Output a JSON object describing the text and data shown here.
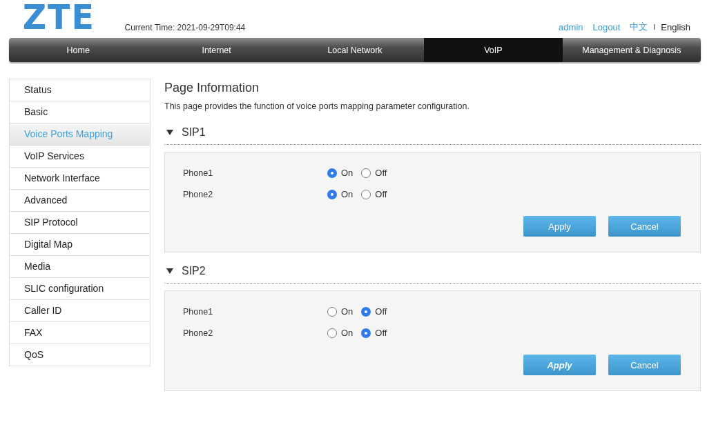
{
  "header": {
    "logo": "ZTE",
    "current_time": "Current Time: 2021-09-29T09:44",
    "user": "admin",
    "logout": "Logout",
    "languages": [
      {
        "label": "中文",
        "selected": false
      },
      {
        "label": "English",
        "selected": true
      }
    ],
    "language_separator": "I"
  },
  "nav": [
    {
      "label": "Home",
      "selected": false
    },
    {
      "label": "Internet",
      "selected": false
    },
    {
      "label": "Local Network",
      "selected": false
    },
    {
      "label": "VoIP",
      "selected": true
    },
    {
      "label": "Management & Diagnosis",
      "selected": false
    }
  ],
  "sidebar": {
    "items": [
      {
        "label": "Status",
        "selected": false
      },
      {
        "label": "Basic",
        "selected": false
      },
      {
        "label": "Voice Ports Mapping",
        "selected": true
      },
      {
        "label": "VoIP Services",
        "selected": false
      },
      {
        "label": "Network Interface",
        "selected": false
      },
      {
        "label": "Advanced",
        "selected": false
      },
      {
        "label": "SIP Protocol",
        "selected": false
      },
      {
        "label": "Digital Map",
        "selected": false
      },
      {
        "label": "Media",
        "selected": false
      },
      {
        "label": "SLIC configuration",
        "selected": false
      },
      {
        "label": "Caller ID",
        "selected": false
      },
      {
        "label": "FAX",
        "selected": false
      },
      {
        "label": "QoS",
        "selected": false
      }
    ]
  },
  "page": {
    "title": "Page Information",
    "description": "This page provides the function of voice ports mapping parameter configuration."
  },
  "sections": [
    {
      "title": "SIP1",
      "expanded": true,
      "rows": [
        {
          "label": "Phone1",
          "options": [
            {
              "label": "On",
              "selected": true
            },
            {
              "label": "Off",
              "selected": false
            }
          ]
        },
        {
          "label": "Phone2",
          "options": [
            {
              "label": "On",
              "selected": true
            },
            {
              "label": "Off",
              "selected": false
            }
          ]
        }
      ],
      "buttons": [
        {
          "label": "Apply",
          "hovered": false
        },
        {
          "label": "Cancel",
          "hovered": false
        }
      ]
    },
    {
      "title": "SIP2",
      "expanded": true,
      "rows": [
        {
          "label": "Phone1",
          "options": [
            {
              "label": "On",
              "selected": false
            },
            {
              "label": "Off",
              "selected": true
            }
          ]
        },
        {
          "label": "Phone2",
          "options": [
            {
              "label": "On",
              "selected": false
            },
            {
              "label": "Off",
              "selected": true
            }
          ]
        }
      ],
      "buttons": [
        {
          "label": "Apply",
          "hovered": true
        },
        {
          "label": "Cancel",
          "hovered": false
        }
      ]
    }
  ]
}
